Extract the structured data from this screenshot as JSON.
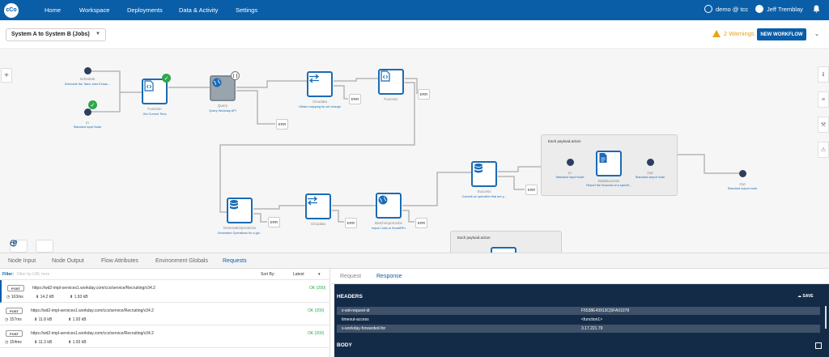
{
  "nav": {
    "logo": "cCo",
    "items": [
      "Home",
      "Workspace",
      "Deployments",
      "Data & Activity",
      "Settings"
    ],
    "account": "demo @ tcc",
    "user": "Jeff Tremblay"
  },
  "toolbar": {
    "workflow_name": "System A to System B (Jobs)",
    "warnings": "2 Warnings",
    "new_workflow": "NEW WORKFLOW"
  },
  "canvas": {
    "nodes": {
      "schedule": {
        "label": "Schedule",
        "sub": "Schedule the Talen Jobs Extrac..."
      },
      "in1": {
        "label": "In",
        "sub": "Standard input Node"
      },
      "function1": {
        "label": "Function",
        "sub": "Get Current Time"
      },
      "query": {
        "label": "Query",
        "sub": "Query Workday API"
      },
      "cloudata1": {
        "label": "Cloudata",
        "sub": "Obtain mapping for sel change"
      },
      "function2": {
        "label": "Function",
        "sub": ""
      },
      "success": {
        "label": "Success",
        "sub": "Commit an operation that are y..."
      },
      "group1_title": "Each payload.action",
      "in2": {
        "label": "In",
        "sub": "Standard Input Node"
      },
      "datasuccess": {
        "label": "DataSuccess",
        "sub": "Report the Success of a specifi..."
      },
      "out1": {
        "label": "Out",
        "sub": "Standard output node"
      },
      "out2": {
        "label": "Out",
        "sub": "Standard output node"
      },
      "genops": {
        "label": "GenerateOperations",
        "sub": "Generates Operations for a giv..."
      },
      "cloudata2": {
        "label": "Cloudata",
        "sub": ""
      },
      "batch": {
        "label": "BatchImportJobs",
        "sub": "Import Jobs to SmartRFx"
      },
      "group2_title": "Each payload.action"
    },
    "err_label": "ERR"
  },
  "tabs": [
    "Node Input",
    "Node Output",
    "Flow Attributes",
    "Environment Globals",
    "Requests"
  ],
  "requests": {
    "filter_label": "Filter:",
    "filter_placeholder": "Filter by URL here",
    "sort_label": "Sort By:",
    "sort_value": "Latest",
    "rows": [
      {
        "method": "POST",
        "url": "https://wd2-impl-services1.workday.com/ccx/service/Recruiting/v34.2",
        "status": "OK (200)",
        "time": "163ms",
        "down": "14.2 kB",
        "up": "1.93 kB"
      },
      {
        "method": "POST",
        "url": "https://wd2-impl-services1.workday.com/ccx/service/Recruiting/v34.2",
        "status": "OK (200)",
        "time": "157ms",
        "down": "11.8 kB",
        "up": "1.93 kB"
      },
      {
        "method": "POST",
        "url": "https://wd2-impl-services1.workday.com/ccx/service/Recruiting/v34.2",
        "status": "OK (200)",
        "time": "154ms",
        "down": "11.3 kB",
        "up": "1.93 kB"
      }
    ]
  },
  "response": {
    "tabs": [
      "Request",
      "Response"
    ],
    "headers_title": "HEADERS",
    "save": "SAVE",
    "headers": [
      {
        "key": "x-wd-request-id",
        "value": "F5538E43913C|5FA01078"
      },
      {
        "key": "timeout-access",
        "value": "<function1>"
      },
      {
        "key": "x-workday-forwarded-for",
        "value": "3.17.221.79"
      }
    ],
    "body_title": "BODY"
  },
  "colors": {
    "brand": "#0a5ea8",
    "success": "#2ea84a",
    "warning": "#e8a317",
    "dark": "#142b48"
  }
}
